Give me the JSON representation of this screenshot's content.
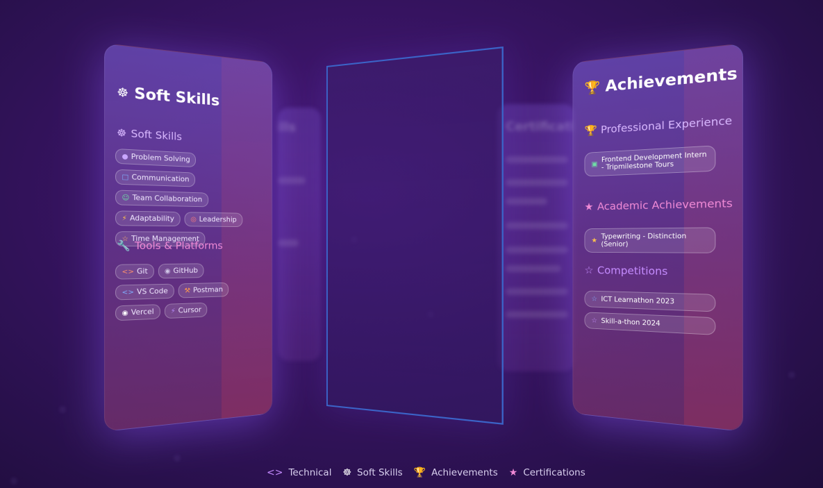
{
  "soft_panel": {
    "title": "Soft Skills",
    "section_soft": "Soft Skills",
    "soft_chips": [
      {
        "label": "Problem Solving",
        "icon": "puzzle-icon",
        "color": "#c9a6ff"
      },
      {
        "label": "Communication",
        "icon": "chat-icon",
        "color": "#7fb0ff"
      },
      {
        "label": "Team Collaboration",
        "icon": "users-icon",
        "color": "#6fe0a6"
      },
      {
        "label": "Adaptability",
        "icon": "lightning-icon",
        "color": "#ffc24d"
      },
      {
        "label": "Leadership",
        "icon": "target-icon",
        "color": "#ff7a7a"
      },
      {
        "label": "Time Management",
        "icon": "star-icon",
        "color": "#ffb36b"
      }
    ],
    "section_tools": "Tools & Platforms",
    "tool_chips": [
      {
        "label": "Git",
        "icon": "code-icon",
        "color": "#ff8f6b"
      },
      {
        "label": "GitHub",
        "icon": "github-icon",
        "color": "#cfc6e6"
      },
      {
        "label": "VS Code",
        "icon": "code-icon",
        "color": "#7fb0ff"
      },
      {
        "label": "Postman",
        "icon": "wrench-icon",
        "color": "#ff9a4d"
      },
      {
        "label": "Vercel",
        "icon": "globe-icon",
        "color": "#ffffff"
      },
      {
        "label": "Cursor",
        "icon": "lightning-icon",
        "color": "#b98cff"
      }
    ]
  },
  "ach_panel": {
    "title": "Achievements",
    "professional": {
      "heading": "Professional Experience",
      "items": [
        "Frontend Development Intern - Tripmilestone Tours"
      ]
    },
    "academic": {
      "heading": "Academic Achievements",
      "items": [
        "Typewriting - Distinction (Senior)"
      ]
    },
    "competitions": {
      "heading": "Competitions",
      "items": [
        "ICT Learnathon 2023",
        "Skill-a-thon 2024"
      ]
    }
  },
  "bg_cards": {
    "left_title": "Technical Skills",
    "right_title": "Certifications"
  },
  "nav": [
    {
      "label": "Technical",
      "icon": "code-icon"
    },
    {
      "label": "Soft Skills",
      "icon": "brain-icon"
    },
    {
      "label": "Achievements",
      "icon": "trophy-icon"
    },
    {
      "label": "Certifications",
      "icon": "award-icon"
    }
  ],
  "colors": {
    "accent_pink": "#f08ad6",
    "accent_purple": "#c58cff",
    "frame_border": "#3b64c8"
  }
}
